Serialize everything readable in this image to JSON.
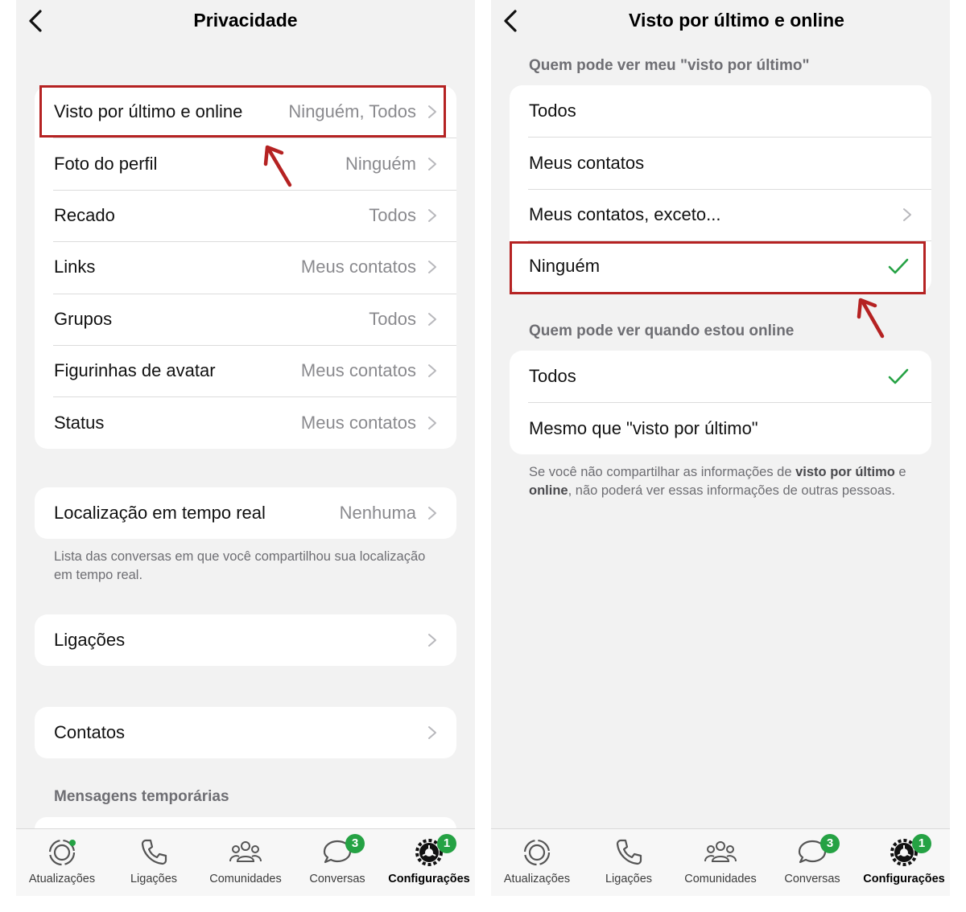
{
  "left": {
    "title": "Privacidade",
    "main_list": [
      {
        "label": "Visto por último e online",
        "value": "Ninguém, Todos"
      },
      {
        "label": "Foto do perfil",
        "value": "Ninguém"
      },
      {
        "label": "Recado",
        "value": "Todos"
      },
      {
        "label": "Links",
        "value": "Meus contatos"
      },
      {
        "label": "Grupos",
        "value": "Todos"
      },
      {
        "label": "Figurinhas de avatar",
        "value": "Meus contatos"
      },
      {
        "label": "Status",
        "value": "Meus contatos"
      }
    ],
    "live_location": {
      "label": "Localização em tempo real",
      "value": "Nenhuma"
    },
    "live_location_note": "Lista das conversas em que você compartilhou sua localização em tempo real.",
    "calls": {
      "label": "Ligações"
    },
    "contacts": {
      "label": "Contatos"
    },
    "temp_messages_header": "Mensagens temporárias"
  },
  "right": {
    "title": "Visto por último e online",
    "last_seen_header": "Quem pode ver meu \"visto por último\"",
    "last_seen_options": [
      {
        "label": "Todos"
      },
      {
        "label": "Meus contatos"
      },
      {
        "label": "Meus contatos, exceto..."
      },
      {
        "label": "Ninguém"
      }
    ],
    "online_header": "Quem pode ver quando estou online",
    "online_options": [
      {
        "label": "Todos"
      },
      {
        "label": "Mesmo que \"visto por último\""
      }
    ],
    "footnote": {
      "t1": "Se você não compartilhar as informações de ",
      "b1": "visto por último",
      "t2": " e ",
      "b2": "online",
      "t3": ", não poderá ver essas informações de outras pessoas."
    }
  },
  "tabbar": {
    "tabs": [
      {
        "label": "Atualizações",
        "icon": "updates-icon"
      },
      {
        "label": "Ligações",
        "icon": "phone-icon"
      },
      {
        "label": "Comunidades",
        "icon": "communities-icon"
      },
      {
        "label": "Conversas",
        "icon": "chats-icon",
        "badge": "3"
      },
      {
        "label": "Configurações",
        "icon": "settings-icon",
        "badge": "1"
      }
    ]
  },
  "colors": {
    "accent": "#25a244",
    "annotation": "#b52222",
    "background": "#f2f2f2"
  }
}
